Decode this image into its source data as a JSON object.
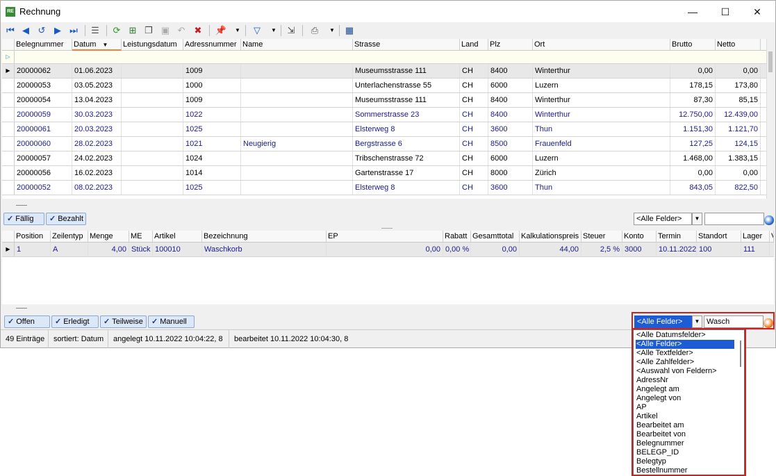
{
  "window": {
    "title": "Rechnung",
    "app_icon": "RE",
    "minimize": "—",
    "maximize": "☐",
    "close": "✕"
  },
  "toolbar": {
    "icons": [
      "first-record-icon",
      "prev-record-icon",
      "refresh-back-icon",
      "next-record-icon",
      "last-record-icon",
      "form-view-icon",
      "reload-icon",
      "new-record-icon",
      "copy-record-icon",
      "save-icon",
      "undo-icon",
      "delete-icon",
      "pin-icon",
      "pin-dropdown-icon",
      "filter-icon",
      "filter-dropdown-icon",
      "export-icon",
      "print-icon",
      "print-dropdown-icon",
      "calculator-icon"
    ]
  },
  "main_grid": {
    "columns": [
      "Belegnummer",
      "Datum",
      "Leistungsdatum",
      "Adressnummer",
      "Name",
      "Strasse",
      "Land",
      "Plz",
      "Ort",
      "Brutto",
      "Netto"
    ],
    "sort_indicator": "▼",
    "rows": [
      {
        "belegnummer": "20000062",
        "datum": "01.06.2023",
        "leistungsdatum": "",
        "adressnummer": "1009",
        "name": "",
        "strasse": "Museumsstrasse 111",
        "land": "CH",
        "plz": "8400",
        "ort": "Winterthur",
        "brutto": "0,00",
        "netto": "0,00",
        "blue": false,
        "selected": true
      },
      {
        "belegnummer": "20000053",
        "datum": "03.05.2023",
        "leistungsdatum": "",
        "adressnummer": "1000",
        "name": "",
        "strasse": "Unterlachenstrasse 55",
        "land": "CH",
        "plz": "6000",
        "ort": "Luzern",
        "brutto": "178,15",
        "netto": "173,80",
        "blue": false,
        "selected": false
      },
      {
        "belegnummer": "20000054",
        "datum": "13.04.2023",
        "leistungsdatum": "",
        "adressnummer": "1009",
        "name": "",
        "strasse": "Museumsstrasse 111",
        "land": "CH",
        "plz": "8400",
        "ort": "Winterthur",
        "brutto": "87,30",
        "netto": "85,15",
        "blue": false,
        "selected": false
      },
      {
        "belegnummer": "20000059",
        "datum": "30.03.2023",
        "leistungsdatum": "",
        "adressnummer": "1022",
        "name": "",
        "strasse": "Sommerstrasse 23",
        "land": "CH",
        "plz": "8400",
        "ort": "Winterthur",
        "brutto": "12.750,00",
        "netto": "12.439,00",
        "blue": true,
        "selected": false
      },
      {
        "belegnummer": "20000061",
        "datum": "20.03.2023",
        "leistungsdatum": "",
        "adressnummer": "1025",
        "name": "",
        "strasse": "Elsterweg 8",
        "land": "CH",
        "plz": "3600",
        "ort": "Thun",
        "brutto": "1.151,30",
        "netto": "1.121,70",
        "blue": true,
        "selected": false
      },
      {
        "belegnummer": "20000060",
        "datum": "28.02.2023",
        "leistungsdatum": "",
        "adressnummer": "1021",
        "name": "Neugierig",
        "strasse": "Bergstrasse 6",
        "land": "CH",
        "plz": "8500",
        "ort": "Frauenfeld",
        "brutto": "127,25",
        "netto": "124,15",
        "blue": true,
        "selected": false
      },
      {
        "belegnummer": "20000057",
        "datum": "24.02.2023",
        "leistungsdatum": "",
        "adressnummer": "1024",
        "name": "",
        "strasse": "Tribschenstrasse 72",
        "land": "CH",
        "plz": "6000",
        "ort": "Luzern",
        "brutto": "1.468,00",
        "netto": "1.383,15",
        "blue": false,
        "selected": false
      },
      {
        "belegnummer": "20000056",
        "datum": "16.02.2023",
        "leistungsdatum": "",
        "adressnummer": "1014",
        "name": "",
        "strasse": "Gartenstrasse 17",
        "land": "CH",
        "plz": "8000",
        "ort": "Zürich",
        "brutto": "0,00",
        "netto": "0,00",
        "blue": false,
        "selected": false
      },
      {
        "belegnummer": "20000052",
        "datum": "08.02.2023",
        "leistungsdatum": "",
        "adressnummer": "1025",
        "name": "",
        "strasse": "Elsterweg 8",
        "land": "CH",
        "plz": "3600",
        "ort": "Thun",
        "brutto": "843,05",
        "netto": "822,50",
        "blue": true,
        "selected": false
      }
    ]
  },
  "top_filter": {
    "faellig": "Fällig",
    "bezahlt": "Bezahlt",
    "field_combo": "<Alle Felder>",
    "search_value": ""
  },
  "detail_grid": {
    "columns": [
      "Position",
      "Zeilentyp",
      "Menge",
      "ME",
      "Artikel",
      "Bezeichnung",
      "EP",
      "Rabatt",
      "Gesamttotal",
      "Kalkulationspreis",
      "Steuer",
      "Konto",
      "Termin",
      "Standort",
      "Lager",
      "V"
    ],
    "rows": [
      {
        "position": "1",
        "zeilentyp": "A",
        "menge": "4,00",
        "me": "Stück",
        "artikel": "100010",
        "bezeichnung": "Waschkorb",
        "ep": "0,00",
        "rabatt": "0,00 %",
        "gesamttotal": "0,00",
        "kalkulationspreis": "44,00",
        "steuer": "2,5 %",
        "konto": "3000",
        "termin": "10.11.2022",
        "standort": "100",
        "lager": "111",
        "v": ""
      }
    ]
  },
  "bottom_filter": {
    "offen": "Offen",
    "erledigt": "Erledigt",
    "teilweise": "Teilweise",
    "manuell": "Manuell",
    "field_combo": "<Alle Felder>",
    "search_value": "Wasch"
  },
  "statusbar": {
    "entries": "49 Einträge",
    "sorted": "sortiert: Datum",
    "created": "angelegt 10.11.2022 10:04:22,  8",
    "edited": "bearbeitet 10.11.2022 10:04:30,  8"
  },
  "dropdown": {
    "items": [
      "<Alle Datumsfelder>",
      "<Alle Felder>",
      "<Alle Textfelder>",
      "<Alle Zahlfelder>",
      "<Auswahl von Feldern>",
      "AdressNr",
      "Angelegt am",
      "Angelegt von",
      "AP",
      "Artikel",
      "Bearbeitet am",
      "Bearbeitet von",
      "Belegnummer",
      "BELEGP_ID",
      "Belegtyp",
      "Bestellnummer"
    ],
    "active_index": 1
  },
  "colors": {
    "highlight": "#1e5cd6",
    "blue_text": "#1a1a8c",
    "red_box": "#d02020"
  }
}
